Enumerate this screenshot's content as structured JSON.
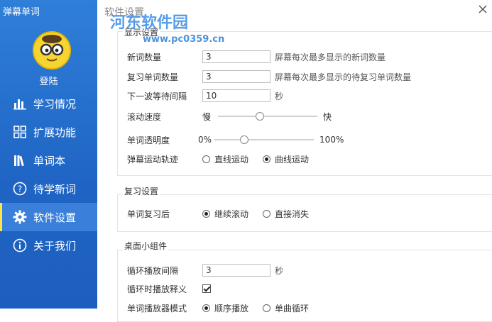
{
  "app": {
    "title": "弹幕单词",
    "login": "登陆"
  },
  "watermark": {
    "line1": "河东软件园",
    "line2": "www.pc0359.cn"
  },
  "nav": [
    {
      "label": "学习情况",
      "icon": "bar-chart-icon"
    },
    {
      "label": "扩展功能",
      "icon": "grid-icon"
    },
    {
      "label": "单词本",
      "icon": "books-icon"
    },
    {
      "label": "待学新词",
      "icon": "question-icon"
    },
    {
      "label": "软件设置",
      "icon": "gear-icon",
      "active": true
    },
    {
      "label": "关于我们",
      "icon": "info-icon"
    }
  ],
  "window": {
    "title": "软件设置"
  },
  "display": {
    "title": "显示设置",
    "new_words": {
      "label": "新词数量",
      "value": "3",
      "hint": "屏幕每次最多显示的新词数量"
    },
    "review_words": {
      "label": "复习单词数量",
      "value": "3",
      "hint": "屏幕每次最多显示的待复习单词数量"
    },
    "wave_interval": {
      "label": "下一波等待间隔",
      "value": "10",
      "unit": "秒"
    },
    "scroll_speed": {
      "label": "滚动速度",
      "min_label": "慢",
      "max_label": "快",
      "level": 0.42
    },
    "opacity": {
      "label": "单词透明度",
      "min_label": "0%",
      "max_label": "100%",
      "level": 0.3
    },
    "trajectory": {
      "label": "弹幕运动轨迹",
      "options": [
        "直线运动",
        "曲线运动"
      ],
      "selected": "曲线运动"
    }
  },
  "review": {
    "title": "复习设置",
    "after_review": {
      "label": "单词复习后",
      "options": [
        "继续滚动",
        "直接消失"
      ],
      "selected": "继续滚动"
    }
  },
  "widget": {
    "title": "桌面小组件",
    "loop_interval": {
      "label": "循环播放间隔",
      "value": "3",
      "unit": "秒"
    },
    "loop_definition": {
      "label": "循环时播放释义",
      "checked": true
    },
    "player_mode": {
      "label": "单词播放器模式",
      "options": [
        "顺序播放",
        "单曲循环"
      ],
      "selected": "顺序播放"
    }
  }
}
